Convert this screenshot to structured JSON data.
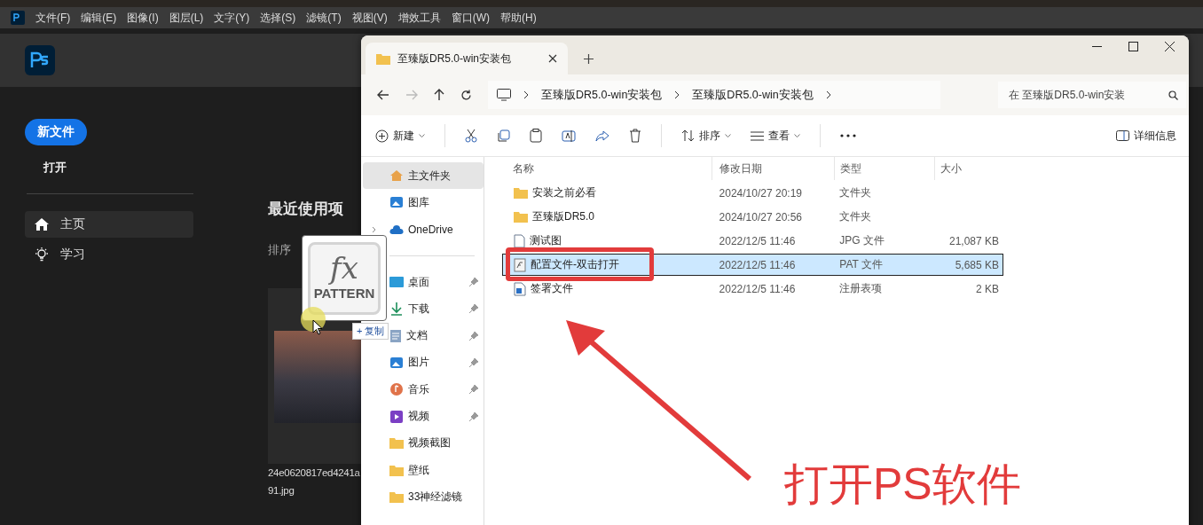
{
  "photoshop": {
    "menu": [
      "文件(F)",
      "编辑(E)",
      "图像(I)",
      "图层(L)",
      "文字(Y)",
      "选择(S)",
      "滤镜(T)",
      "视图(V)",
      "增效工具",
      "窗口(W)",
      "帮助(H)"
    ],
    "new_file_button": "新文件",
    "open_link": "打开",
    "nav": [
      {
        "label": "主页",
        "kind": "home",
        "selected": true
      },
      {
        "label": "学习",
        "kind": "bulb",
        "selected": false
      }
    ],
    "recent": {
      "title": "最近使用项",
      "sort_label": "排序",
      "file_name_lines": [
        "24e0620817ed4241a",
        "91.jpg"
      ]
    }
  },
  "explorer": {
    "tab": {
      "title": "至臻版DR5.0-win安装包"
    },
    "breadcrumb": [
      "至臻版DR5.0-win安装包",
      "至臻版DR5.0-win安装包"
    ],
    "search": {
      "placeholder": "在 至臻版DR5.0-win安装"
    },
    "toolbar": {
      "new": "新建",
      "sort": "排序",
      "view": "查看",
      "details": "详细信息"
    },
    "nav_pane": [
      {
        "label": "主文件夹",
        "kind": "home",
        "selected": true,
        "pinned": false,
        "expandable": false
      },
      {
        "label": "图库",
        "kind": "gallery",
        "selected": false,
        "pinned": false,
        "expandable": false
      },
      {
        "label": "OneDrive",
        "kind": "cloud",
        "selected": false,
        "pinned": false,
        "expandable": true
      },
      {
        "kind": "divider"
      },
      {
        "label": "桌面",
        "kind": "desktop",
        "selected": false,
        "pinned": true,
        "expandable": false
      },
      {
        "label": "下载",
        "kind": "download",
        "selected": false,
        "pinned": true,
        "expandable": false
      },
      {
        "label": "文档",
        "kind": "document",
        "selected": false,
        "pinned": true,
        "expandable": false
      },
      {
        "label": "图片",
        "kind": "picture",
        "selected": false,
        "pinned": true,
        "expandable": false
      },
      {
        "label": "音乐",
        "kind": "music",
        "selected": false,
        "pinned": true,
        "expandable": false
      },
      {
        "label": "视频",
        "kind": "video",
        "selected": false,
        "pinned": true,
        "expandable": false
      },
      {
        "label": "视频截图",
        "kind": "folder",
        "selected": false,
        "pinned": false,
        "expandable": false
      },
      {
        "label": "壁纸",
        "kind": "folder",
        "selected": false,
        "pinned": false,
        "expandable": false
      },
      {
        "label": "33神经滤镜",
        "kind": "folder",
        "selected": false,
        "pinned": false,
        "expandable": false
      }
    ],
    "columns": [
      "名称",
      "修改日期",
      "类型",
      "大小"
    ],
    "rows": [
      {
        "name": "安装之前必看",
        "date": "2024/10/27 20:19",
        "type": "文件夹",
        "size": "",
        "kind": "folder",
        "selected": false
      },
      {
        "name": "至臻版DR5.0",
        "date": "2024/10/27 20:56",
        "type": "文件夹",
        "size": "",
        "kind": "folder",
        "selected": false
      },
      {
        "name": "测试图",
        "date": "2022/12/5 11:46",
        "type": "JPG 文件",
        "size": "21,087 KB",
        "kind": "image",
        "selected": false
      },
      {
        "name": "配置文件-双击打开",
        "date": "2022/12/5 11:46",
        "type": "PAT 文件",
        "size": "5,685 KB",
        "kind": "pattern",
        "selected": true
      },
      {
        "name": "签署文件",
        "date": "2022/12/5 11:46",
        "type": "注册表项",
        "size": "2 KB",
        "kind": "registry",
        "selected": false
      }
    ]
  },
  "drag": {
    "glyph": "fx",
    "label": "PATTERN",
    "action": "+ 复制"
  },
  "annotation": {
    "text": "打开PS软件"
  }
}
